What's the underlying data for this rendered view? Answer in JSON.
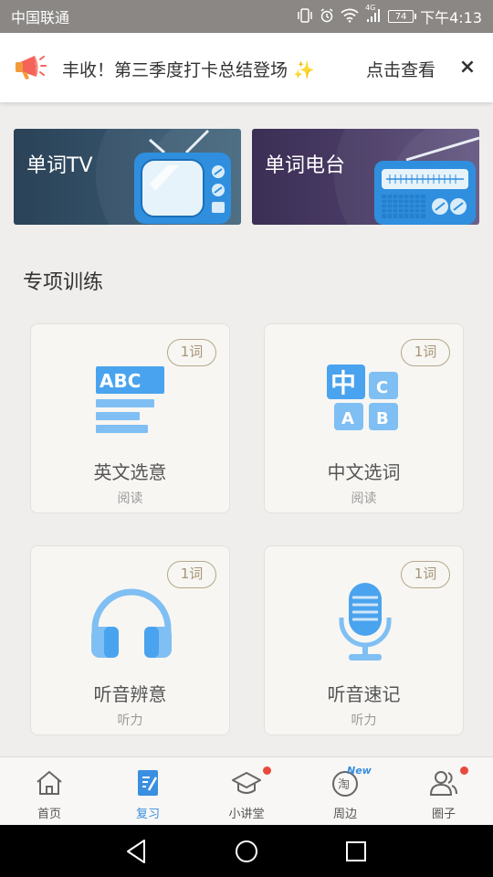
{
  "status_bar": {
    "carrier": "中国联通",
    "network": "4G",
    "battery": "74",
    "time": "下午4:13"
  },
  "banner": {
    "text": "丰收！第三季度打卡总结登场",
    "link": "点击查看",
    "close": "×"
  },
  "media": [
    {
      "title": "单词TV"
    },
    {
      "title": "单词电台"
    }
  ],
  "section": {
    "title": "专项训练"
  },
  "trainings": [
    {
      "name": "英文选意",
      "category": "阅读",
      "badge": "1词",
      "icon": "abc-text-icon"
    },
    {
      "name": "中文选词",
      "category": "阅读",
      "badge": "1词",
      "icon": "chinese-abc-blocks-icon"
    },
    {
      "name": "听音辨意",
      "category": "听力",
      "badge": "1词",
      "icon": "headphones-icon"
    },
    {
      "name": "听音速记",
      "category": "听力",
      "badge": "1词",
      "icon": "microphone-icon"
    }
  ],
  "bottom_nav": [
    {
      "label": "首页",
      "icon": "home-icon",
      "active": false
    },
    {
      "label": "复习",
      "icon": "review-icon",
      "active": true
    },
    {
      "label": "小讲堂",
      "icon": "graduation-cap-icon",
      "dot": true
    },
    {
      "label": "周边",
      "icon": "taobao-icon",
      "new": "New"
    },
    {
      "label": "圈子",
      "icon": "people-icon",
      "dot": true
    }
  ],
  "colors": {
    "accent": "#3a8fe0",
    "icon_blue": "#4aa3ee",
    "badge": "#a69577",
    "dot": "#e84a3c"
  }
}
